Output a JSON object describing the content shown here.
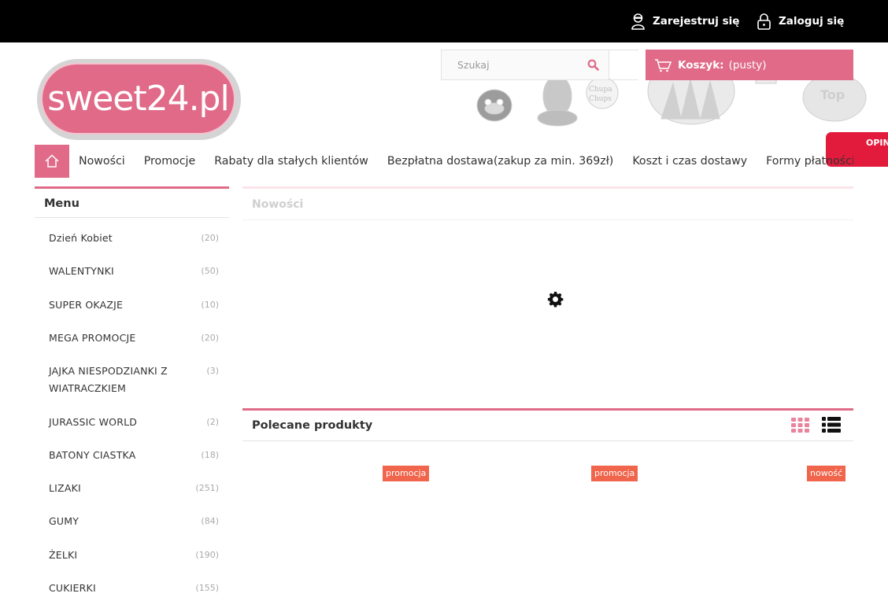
{
  "top_bar": {
    "register_label": "Zarejestruj się",
    "login_label": "Zaloguj się"
  },
  "logo": {
    "text": "sweet24.pl"
  },
  "search": {
    "placeholder": "Szukaj"
  },
  "cart": {
    "label": "Koszyk:",
    "status": "(pusty)"
  },
  "opinions_tab": {
    "label": "OPIN"
  },
  "nav": {
    "items": [
      "Nowości",
      "Promocje",
      "Rabaty dla stałych klientów",
      "Bezpłatna dostawa(zakup za min. 369zł)",
      "Koszt i czas dostawy",
      "Formy płatności"
    ]
  },
  "sidebar": {
    "title": "Menu",
    "items": [
      {
        "label": "Dzień Kobiet",
        "count": "(20)"
      },
      {
        "label": "WALENTYNKI",
        "count": "(50)"
      },
      {
        "label": "SUPER OKAZJE",
        "count": "(10)"
      },
      {
        "label": "MEGA PROMOCJE",
        "count": "(20)"
      },
      {
        "label": "JAJKA NIESPODZIANKI Z WIATRACZKIEM",
        "count": "(3)"
      },
      {
        "label": "JURASSIC WORLD",
        "count": "(2)"
      },
      {
        "label": "BATONY CIASTKA",
        "count": "(18)"
      },
      {
        "label": "LIZAKI",
        "count": "(251)"
      },
      {
        "label": "GUMY",
        "count": "(84)"
      },
      {
        "label": "ŻELKI",
        "count": "(190)"
      },
      {
        "label": "CUKIERKI",
        "count": "(155)"
      }
    ]
  },
  "main": {
    "new_section_title": "Nowości",
    "recommended_title": "Polecane produkty",
    "badges": [
      "promocja",
      "promocja",
      "nowość"
    ]
  },
  "colors": {
    "accent_pink": "#e06a88",
    "badge_orange": "#f0654c",
    "opinions_red": "#e21b3c"
  }
}
